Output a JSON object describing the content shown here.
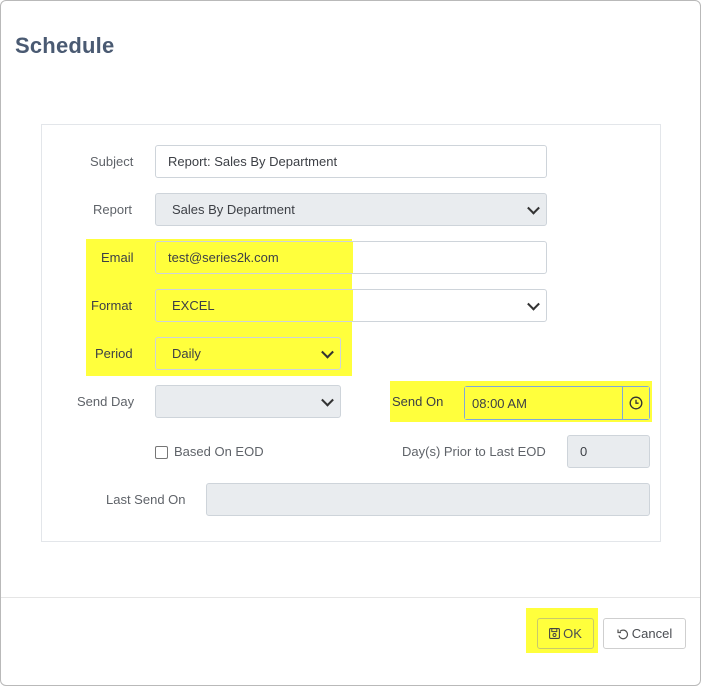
{
  "dialog": {
    "title": "Schedule"
  },
  "form": {
    "subject": {
      "label": "Subject",
      "value": "Report: Sales By Department"
    },
    "report": {
      "label": "Report",
      "value": "Sales By Department"
    },
    "email": {
      "label": "Email",
      "value": "test@series2k.com"
    },
    "format": {
      "label": "Format",
      "value": "EXCEL"
    },
    "period": {
      "label": "Period",
      "value": "Daily"
    },
    "send_day": {
      "label": "Send Day",
      "value": ""
    },
    "send_on": {
      "label": "Send On",
      "value": "08:00 AM"
    },
    "based_on_eod": {
      "label": "Based On EOD",
      "checked": false
    },
    "days_prior": {
      "label": "Day(s) Prior to Last EOD",
      "value": "0"
    },
    "last_send_on": {
      "label": "Last Send On",
      "value": ""
    }
  },
  "footer": {
    "ok_label": "OK",
    "cancel_label": "Cancel"
  },
  "colors": {
    "highlight": "#ffff3c",
    "title": "#4a5a72"
  },
  "icons": {
    "clock": "clock-icon",
    "chevron": "chevron-down-icon",
    "save": "save-icon",
    "undo": "undo-icon"
  }
}
